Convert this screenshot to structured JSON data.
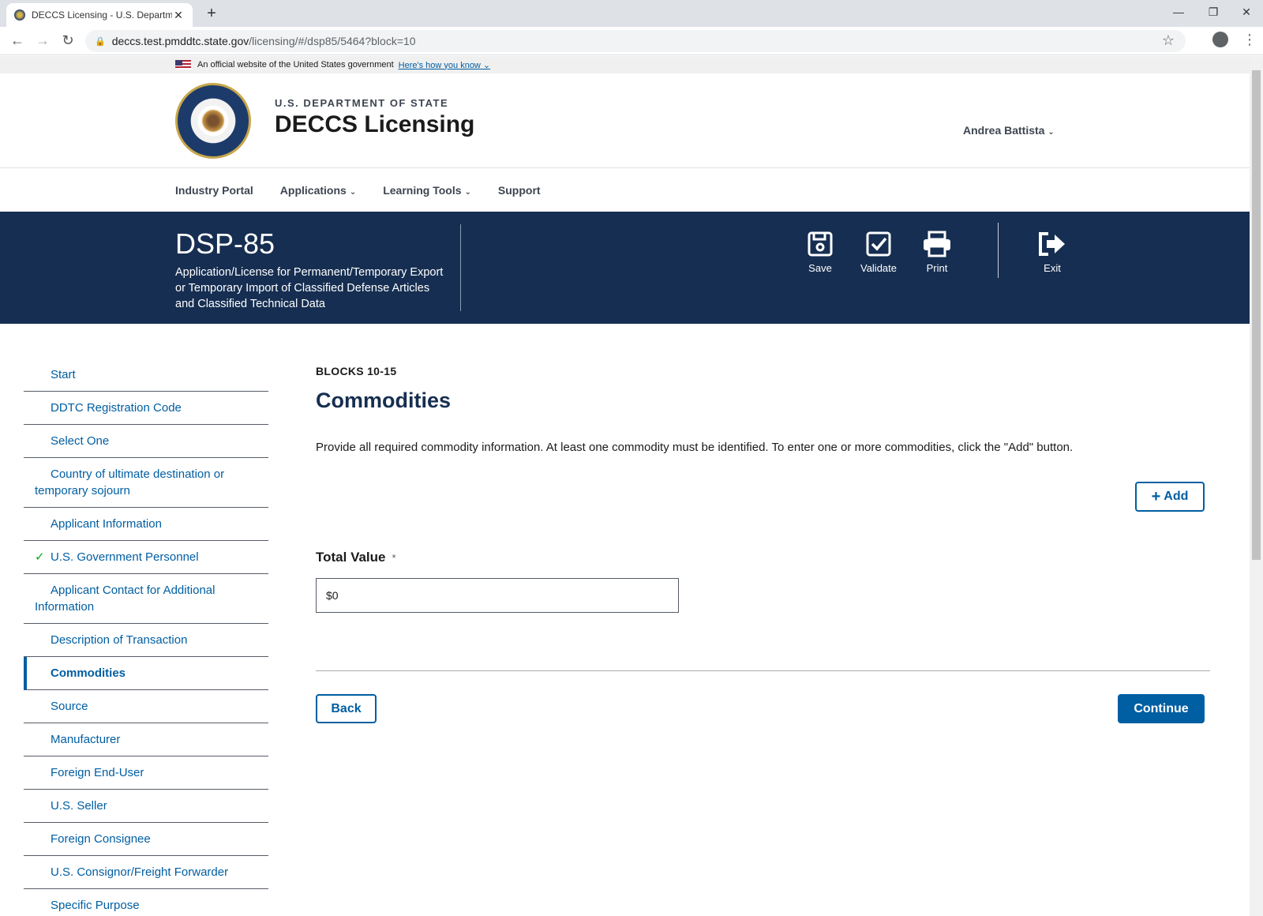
{
  "browser": {
    "tab_title": "DECCS Licensing - U.S. Departme",
    "tab_close": "✕",
    "new_tab": "+",
    "url_host": "deccs.test.pmddtc.state.gov",
    "url_path": "/licensing/#/dsp85/5464?block=10"
  },
  "gov_banner": {
    "text": "An official website of the United States government",
    "link": "Here's how you know ⌄"
  },
  "header": {
    "agency": "U.S. DEPARTMENT OF STATE",
    "app_name": "DECCS Licensing",
    "user_name": "Andrea Battista"
  },
  "nav": {
    "items": [
      {
        "label": "Industry Portal"
      },
      {
        "label": "Applications"
      },
      {
        "label": "Learning Tools"
      },
      {
        "label": "Support"
      }
    ]
  },
  "form_header": {
    "title": "DSP-85",
    "subtitle": "Application/License for Permanent/Temporary Export or Temporary Import of Classified Defense Articles and Classified Technical Data",
    "actions": {
      "save": "Save",
      "validate": "Validate",
      "print": "Print",
      "exit": "Exit"
    }
  },
  "sidebar": {
    "items": [
      {
        "label": "Start"
      },
      {
        "label": "DDTC Registration Code"
      },
      {
        "label": "Select One"
      },
      {
        "label": "Country of ultimate destination or temporary sojourn"
      },
      {
        "label": "Applicant Information"
      },
      {
        "label": "U.S. Government Personnel",
        "completed": true
      },
      {
        "label": "Applicant Contact for Additional Information"
      },
      {
        "label": "Description of Transaction"
      },
      {
        "label": "Commodities",
        "active": true
      },
      {
        "label": "Source"
      },
      {
        "label": "Manufacturer"
      },
      {
        "label": "Foreign End-User"
      },
      {
        "label": "U.S. Seller"
      },
      {
        "label": "Foreign Consignee"
      },
      {
        "label": "U.S. Consignor/Freight Forwarder"
      },
      {
        "label": "Specific Purpose"
      }
    ]
  },
  "main": {
    "eyebrow": "BLOCKS 10-15",
    "title": "Commodities",
    "description": "Provide all required commodity information. At least one commodity must be identified. To enter one or more commodities, click the \"Add\" button.",
    "add_label": "Add",
    "total_value_label": "Total Value",
    "required_mark": "*",
    "total_value": "$0",
    "back_label": "Back",
    "continue_label": "Continue"
  },
  "colors": {
    "primary": "#005ea2",
    "hero_bg": "#162e51",
    "check": "#00a91c"
  }
}
